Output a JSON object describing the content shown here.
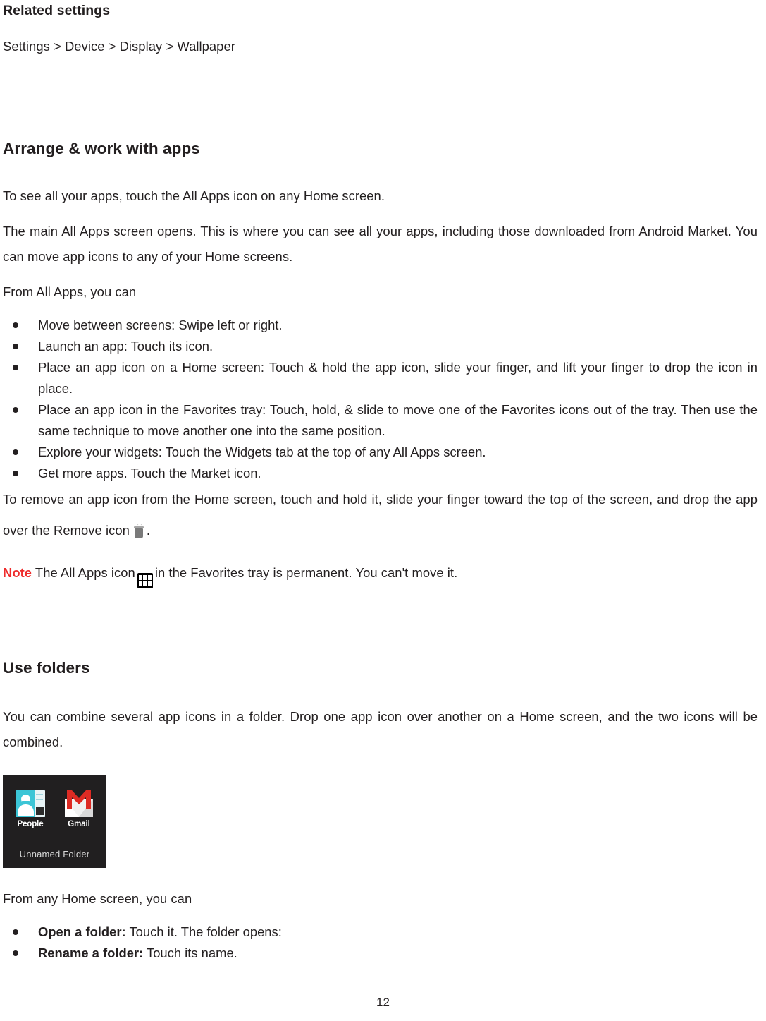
{
  "document": {
    "page_number": "12"
  },
  "related_settings": {
    "heading": "Related settings",
    "path": "Settings > Device > Display > Wallpaper"
  },
  "arrange_apps": {
    "heading": "Arrange & work with apps",
    "intro": "To see all your apps, touch the All Apps icon on any Home screen.",
    "paragraph_2": "The main All Apps screen opens. This is where you can see all your apps, including those downloaded from Android Market. You can move app icons to any of your Home screens.",
    "lead_in": "From All Apps, you can",
    "bullets": [
      "Move between screens: Swipe left or right.",
      "Launch an app: Touch its icon.",
      "Place an app icon on a Home screen: Touch & hold the app icon, slide your finger, and lift your finger to drop the icon in place.",
      "Place an app icon in the Favorites tray: Touch, hold, & slide to move one of the Favorites icons out of the tray. Then use the same technique to move another one into the same position.",
      "Explore your widgets: Touch the Widgets tab at the top of any All Apps screen.",
      "Get more apps. Touch the Market icon."
    ],
    "remove_text_before": "To remove an app icon from the Home screen, touch and hold it, slide your finger toward the top of the screen, and drop the app over the Remove icon",
    "remove_text_after": ".",
    "remove_icon_name": "trash-icon",
    "note_label": "Note",
    "note_color": "#ee2c2c",
    "note_text_before": "The All Apps icon",
    "note_text_after": "in the Favorites tray is permanent. You can't move it.",
    "allapps_icon_name": "all-apps-grid-icon"
  },
  "use_folders": {
    "heading": "Use folders",
    "paragraph": "You can combine several app icons in a folder. Drop one app icon over another on a Home screen, and the two icons will be combined.",
    "screenshot": {
      "background_color": "#211f20",
      "folder_label": "Unnamed Folder",
      "apps": [
        {
          "label": "People",
          "icon": "people-icon",
          "color": "#3cc5d6"
        },
        {
          "label": "Gmail",
          "icon": "gmail-icon",
          "color": "#dd2b24"
        }
      ]
    },
    "lead_in": "From any Home screen, you can",
    "bullets": [
      {
        "bold": "Open a folder:",
        "rest": " Touch it. The folder opens:"
      },
      {
        "bold": "Rename a folder:",
        "rest": " Touch its name."
      }
    ]
  }
}
